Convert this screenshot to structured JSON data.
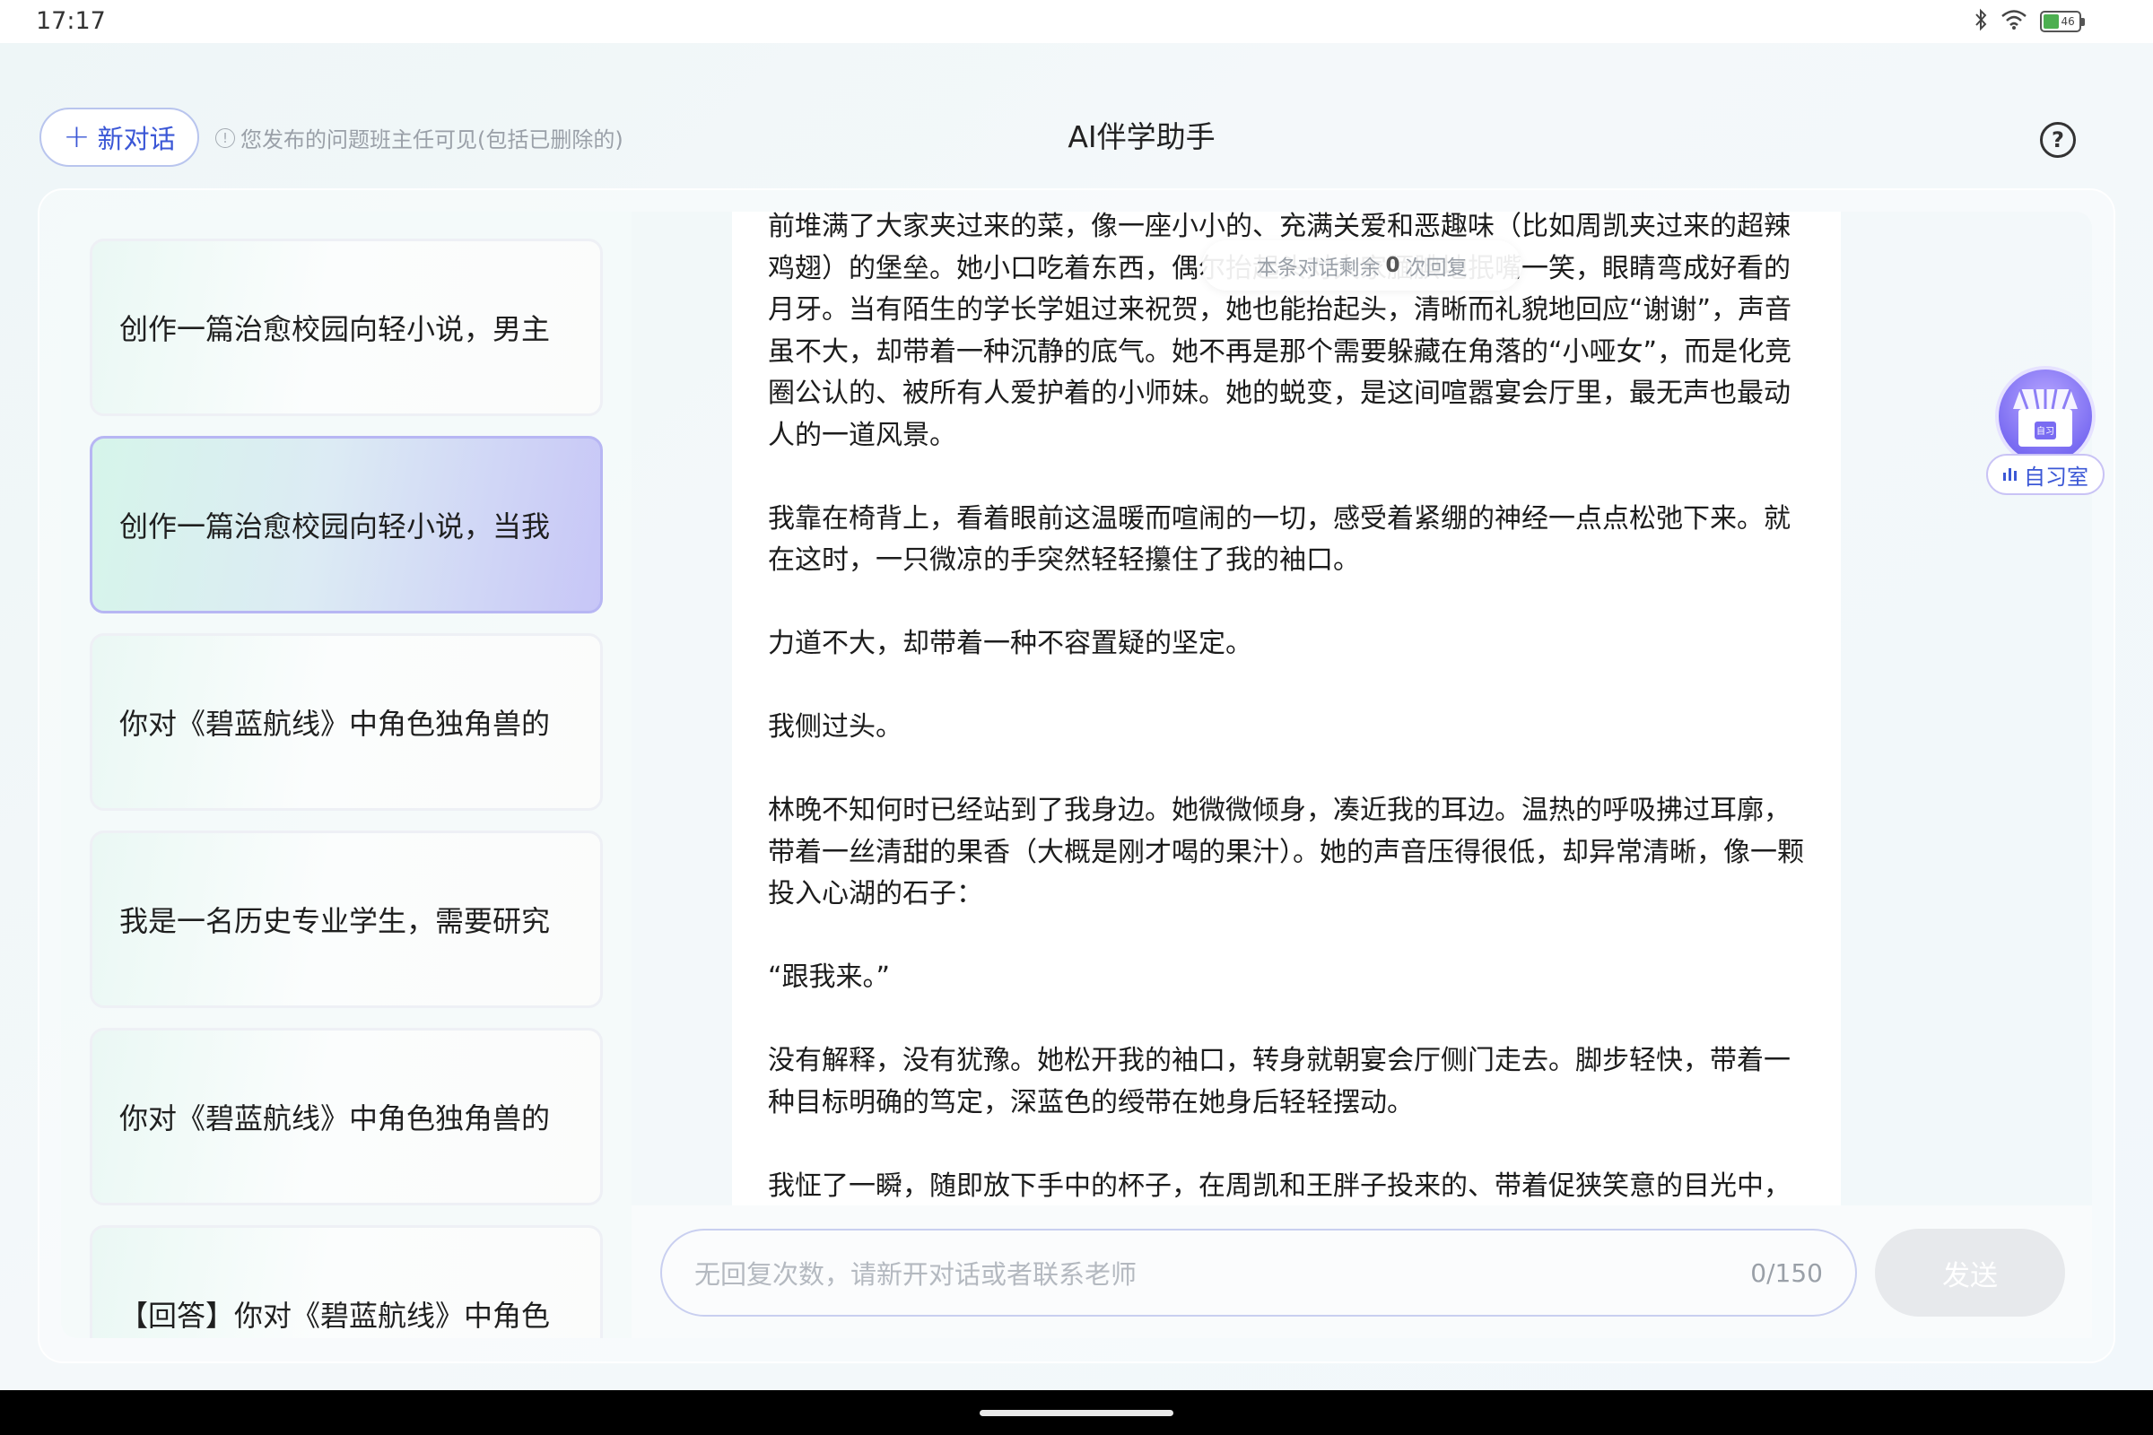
{
  "status_bar": {
    "time": "17:17",
    "battery_level": "46",
    "icons": [
      "bluetooth-icon",
      "wifi-icon",
      "battery-icon"
    ]
  },
  "header": {
    "new_chat_label": "新对话",
    "notice": "您发布的问题班主任可见(包括已删除的)",
    "title": "AI伴学助手"
  },
  "sidebar": {
    "items": [
      {
        "label": "创作一篇治愈校园向轻小说，男主",
        "active": false
      },
      {
        "label": "创作一篇治愈校园向轻小说，当我",
        "active": true
      },
      {
        "label": "你对《碧蓝航线》中角色独角兽的",
        "active": false
      },
      {
        "label": "我是一名历史专业学生，需要研究",
        "active": false
      },
      {
        "label": "你对《碧蓝航线》中角色独角兽的",
        "active": false
      },
      {
        "label": "【回答】你对《碧蓝航线》中角色",
        "active": false
      }
    ]
  },
  "conversation": {
    "remaining_prefix": "本条对话剩余",
    "remaining_count": "0",
    "remaining_suffix": "次回复",
    "paragraphs": [
      "前堆满了大家夹过来的菜，像一座小小的、充满关爱和恶趣味（比如周凯夹过来的超辣鸡翅）的堡垒。她小口吃着东西，偶尔抬起头对大家腼腆地抿嘴一笑，眼睛弯成好看的月牙。当有陌生的学长学姐过来祝贺，她也能抬起头，清晰而礼貌地回应“谢谢”，声音虽不大，却带着一种沉静的底气。她不再是那个需要躲藏在角落的“小哑女”，而是化竞圈公认的、被所有人爱护着的小师妹。她的蜕变，是这间喧嚣宴会厅里，最无声也最动人的一道风景。",
      "我靠在椅背上，看着眼前这温暖而喧闹的一切，感受着紧绷的神经一点点松弛下来。就在这时，一只微凉的手突然轻轻攥住了我的袖口。",
      "力道不大，却带着一种不容置疑的坚定。",
      "我侧过头。",
      "林晚不知何时已经站到了我身边。她微微倾身，凑近我的耳边。温热的呼吸拂过耳廓，带着一丝清甜的果香（大概是刚才喝的果汁）。她的声音压得很低，却异常清晰，像一颗投入心湖的石子：",
      "“跟我来。”",
      "没有解释，没有犹豫。她松开我的袖口，转身就朝宴会厅侧门走去。脚步轻快，带着一种目标明确的笃定，深蓝色的绶带在她身后轻轻摆动。",
      "我怔了一瞬，随即放下手中的杯子，在周凯和王胖子投来的、带着促狭笑意的目光中，"
    ]
  },
  "input": {
    "placeholder": "无回复次数，请新开对话或者联系老师",
    "counter": "0/150",
    "send_label": "发送"
  },
  "floating": {
    "study_room_label": "自习室",
    "study_room_badge": "自习"
  },
  "colors": {
    "accent": "#3b57d6",
    "active_item_end": "#c7c6f7",
    "send_disabled": "#e7e9ec"
  }
}
